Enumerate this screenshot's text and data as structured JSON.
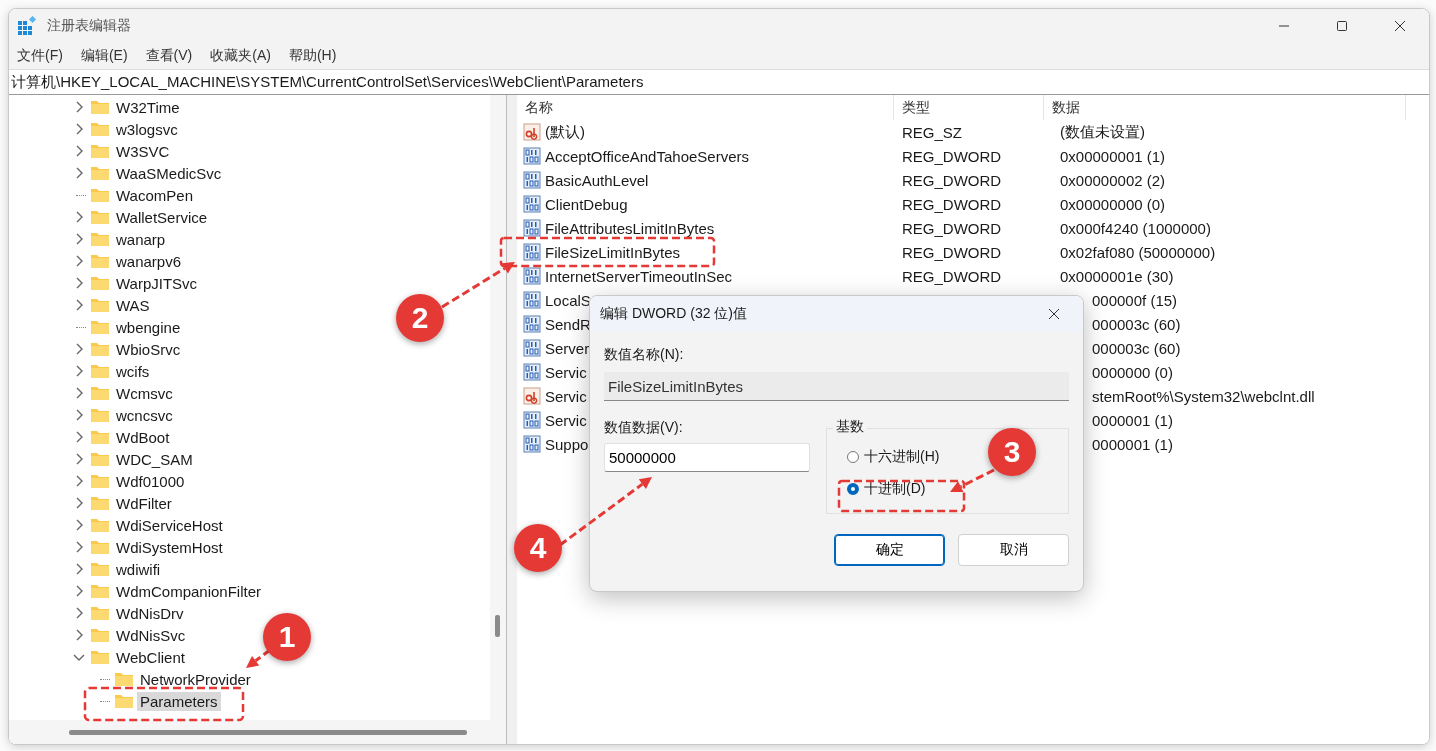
{
  "window": {
    "title": "注册表编辑器"
  },
  "menu": [
    "文件(F)",
    "编辑(E)",
    "查看(V)",
    "收藏夹(A)",
    "帮助(H)"
  ],
  "address": "计算机\\HKEY_LOCAL_MACHINE\\SYSTEM\\CurrentControlSet\\Services\\WebClient\\Parameters",
  "tree": [
    {
      "label": "W32Time",
      "has_children": true,
      "expanded": false,
      "selected": false
    },
    {
      "label": "w3logsvc",
      "has_children": true,
      "expanded": false,
      "selected": false
    },
    {
      "label": "W3SVC",
      "has_children": true,
      "expanded": false,
      "selected": false
    },
    {
      "label": "WaaSMedicSvc",
      "has_children": true,
      "expanded": false,
      "selected": false
    },
    {
      "label": "WacomPen",
      "has_children": false,
      "selected": false
    },
    {
      "label": "WalletService",
      "has_children": true,
      "expanded": false,
      "selected": false
    },
    {
      "label": "wanarp",
      "has_children": true,
      "expanded": false,
      "selected": false
    },
    {
      "label": "wanarpv6",
      "has_children": true,
      "expanded": false,
      "selected": false
    },
    {
      "label": "WarpJITSvc",
      "has_children": true,
      "expanded": false,
      "selected": false
    },
    {
      "label": "WAS",
      "has_children": true,
      "expanded": false,
      "selected": false
    },
    {
      "label": "wbengine",
      "has_children": false,
      "selected": false
    },
    {
      "label": "WbioSrvc",
      "has_children": true,
      "expanded": false,
      "selected": false
    },
    {
      "label": "wcifs",
      "has_children": true,
      "expanded": false,
      "selected": false
    },
    {
      "label": "Wcmsvc",
      "has_children": true,
      "expanded": false,
      "selected": false
    },
    {
      "label": "wcncsvc",
      "has_children": true,
      "expanded": false,
      "selected": false
    },
    {
      "label": "WdBoot",
      "has_children": true,
      "expanded": false,
      "selected": false
    },
    {
      "label": "WDC_SAM",
      "has_children": true,
      "expanded": false,
      "selected": false
    },
    {
      "label": "Wdf01000",
      "has_children": true,
      "expanded": false,
      "selected": false
    },
    {
      "label": "WdFilter",
      "has_children": true,
      "expanded": false,
      "selected": false
    },
    {
      "label": "WdiServiceHost",
      "has_children": true,
      "expanded": false,
      "selected": false
    },
    {
      "label": "WdiSystemHost",
      "has_children": true,
      "expanded": false,
      "selected": false
    },
    {
      "label": "wdiwifi",
      "has_children": true,
      "expanded": false,
      "selected": false
    },
    {
      "label": "WdmCompanionFilter",
      "has_children": true,
      "expanded": false,
      "selected": false
    },
    {
      "label": "WdNisDrv",
      "has_children": true,
      "expanded": false,
      "selected": false
    },
    {
      "label": "WdNisSvc",
      "has_children": true,
      "expanded": false,
      "selected": false
    },
    {
      "label": "WebClient",
      "has_children": true,
      "expanded": true,
      "selected": false,
      "children": [
        {
          "label": "NetworkProvider",
          "has_children": false,
          "selected": false
        },
        {
          "label": "Parameters",
          "has_children": false,
          "selected": true
        }
      ]
    }
  ],
  "columns": [
    "名称",
    "类型",
    "数据"
  ],
  "rows": [
    {
      "kind": "string",
      "name": "(默认)",
      "reg_type": "REG_SZ",
      "data": "(数值未设置)"
    },
    {
      "kind": "dword",
      "name": "AcceptOfficeAndTahoeServers",
      "reg_type": "REG_DWORD",
      "data": "0x00000001 (1)"
    },
    {
      "kind": "dword",
      "name": "BasicAuthLevel",
      "reg_type": "REG_DWORD",
      "data": "0x00000002 (2)"
    },
    {
      "kind": "dword",
      "name": "ClientDebug",
      "reg_type": "REG_DWORD",
      "data": "0x00000000 (0)"
    },
    {
      "kind": "dword",
      "name": "FileAttributesLimitInBytes",
      "reg_type": "REG_DWORD",
      "data": "0x000f4240 (1000000)"
    },
    {
      "kind": "dword",
      "name": "FileSizeLimitInBytes",
      "reg_type": "REG_DWORD",
      "data": "0x02faf080 (50000000)"
    },
    {
      "kind": "dword",
      "name": "InternetServerTimeoutInSec",
      "reg_type": "REG_DWORD",
      "data": "0x0000001e (30)"
    },
    {
      "kind": "dword",
      "name": "LocalS",
      "data": "000000f (15)"
    },
    {
      "kind": "dword",
      "name": "SendR",
      "data": "000003c (60)"
    },
    {
      "kind": "dword",
      "name": "Server",
      "data": "000003c (60)"
    },
    {
      "kind": "dword",
      "name": "Servic",
      "data": "0000000 (0)"
    },
    {
      "kind": "string",
      "name": "Servic",
      "data": "stemRoot%\\System32\\webclnt.dll"
    },
    {
      "kind": "dword",
      "name": "Servic",
      "data": "0000001 (1)"
    },
    {
      "kind": "dword",
      "name": "Suppo",
      "data": "0000001 (1)"
    }
  ],
  "dialog": {
    "title": "编辑 DWORD (32 位)值",
    "name_label": "数值名称(N):",
    "name_value": "FileSizeLimitInBytes",
    "data_label": "数值数据(V):",
    "data_value": "50000000",
    "base_label": "基数",
    "bases": [
      {
        "label": "十六进制(H)",
        "selected": false
      },
      {
        "label": "十进制(D)",
        "selected": true
      }
    ],
    "buttons": [
      {
        "label": "确定",
        "primary": true
      },
      {
        "label": "取消",
        "primary": false
      }
    ]
  },
  "annotations": [
    {
      "label": "1"
    },
    {
      "label": "2"
    },
    {
      "label": "3"
    },
    {
      "label": "4"
    }
  ]
}
